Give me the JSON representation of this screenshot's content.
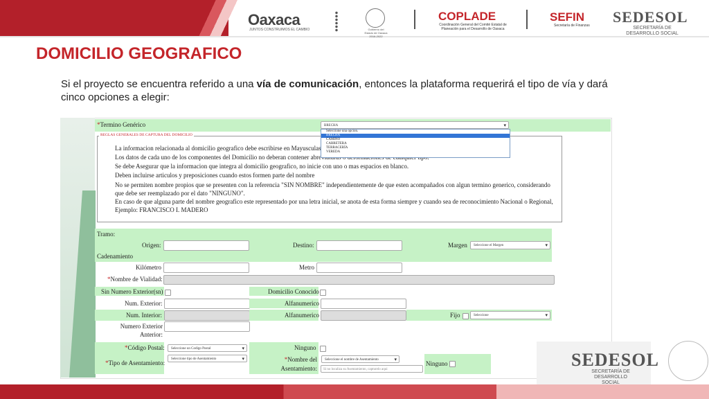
{
  "header": {
    "logo_oaxaca": "Oaxaca",
    "logo_oaxaca_sub": "JUNTOS CONSTRUIMOS EL CAMBIO",
    "seal_caption": "Gobierno del Estado de Oaxaca 2016-2022",
    "coplade": "COPLADE",
    "coplade_sub": "Coordinación General del Comité Estatal de Planeación para el Desarrollo de Oaxaca",
    "sefin": "SEFIN",
    "sefin_sub": "Secretaría de Finanzas",
    "sedesol": "SEDESOL",
    "sedesol_sub": "SECRETARÍA DE DESARROLLO SOCIAL"
  },
  "title": "DOMICILIO GEOGRAFICO",
  "intro": {
    "part1": "Si el proyecto se encuentra referido a una ",
    "bold": "vía de comunicación",
    "part2": ", entonces la plataforma requerirá el tipo de vía y dará cinco opciones a elegir:"
  },
  "form": {
    "termino_label": "Termino Genérico",
    "termino_value": "BRECHA",
    "dropdown_options": [
      "Seleccione una opcion.",
      "BRECHA",
      "CAMINO",
      "CARRETERA",
      "TERRACERÍA",
      "VEREDA"
    ],
    "dropdown_selected_index": 1,
    "rules_legend": "REGLAS GENERALES DE CAPTURA DEL DOMICILIO",
    "rules": [
      "La informacion relacionada al domicilio geografico debe escribirse en Mayusculas y c",
      "Los datos de cada uno de los componentes del Domicilio no deberan contener abreviaturas o deformaciones de cualquier tipo.",
      "Se debe Asegurar que la informacion que integra al domicilio geografico, no inicie con uno o mas espacios en blanco.",
      "Deben incluirse articulos y preposiciones cuando estos formen parte del nombre",
      "No se permiten nombre propios que se presenten con la referencia \"SIN NOMBRE\" independientemente de que esten acompañados con algun termino generico, considerando que debe ser reemplazado por el dato \"NINGUNO\".",
      "En caso de que alguna parte del nombre geografico este representado por una letra inicial, se anota de esta forma siempre y cuando sea de reconocimiento Nacional o Regional, Ejemplo: FRANCISCO I. MADERO"
    ],
    "tramo": "Tramo:",
    "origen": "Origen:",
    "destino": "Destino:",
    "margen": "Margen",
    "margen_value": "Seleccione el Margen",
    "cadenamiento": "Cadenamiento",
    "kilometro": "Kilómetro",
    "metro": "Metro",
    "nombre_vialidad": "Nombre de Vialidad:",
    "sin_numero": "Sin Numero Exterior(sn)",
    "domicilio_conocido": "Domicilio Conocido",
    "num_exterior": "Num. Exterior:",
    "alfanumerico": "Alfanumerico",
    "num_interior": "Num. Interior:",
    "fijo": "Fijo",
    "fijo_value": "Seleccione",
    "numero_exterior_anterior": "Numero Exterior Anterior:",
    "codigo_postal": "Código Postal:",
    "codigo_postal_value": "Seleccione un Codigo Postal",
    "ninguno": "Ninguno",
    "tipo_asentamiento": "Tipo de Asentamiento:",
    "tipo_asentamiento_value": "Seleccione tipo de Asentamiento",
    "nombre_asentamiento": "Nombre del Asentamiento:",
    "nombre_asentamiento_value": "Seleccione el nombre de Asentamiento",
    "asentamiento_placeholder": "Si no localiza su Asentamiento, capturelo aqui"
  },
  "colors": {
    "brand_red": "#c4252a",
    "form_green": "#c6f2c6"
  }
}
